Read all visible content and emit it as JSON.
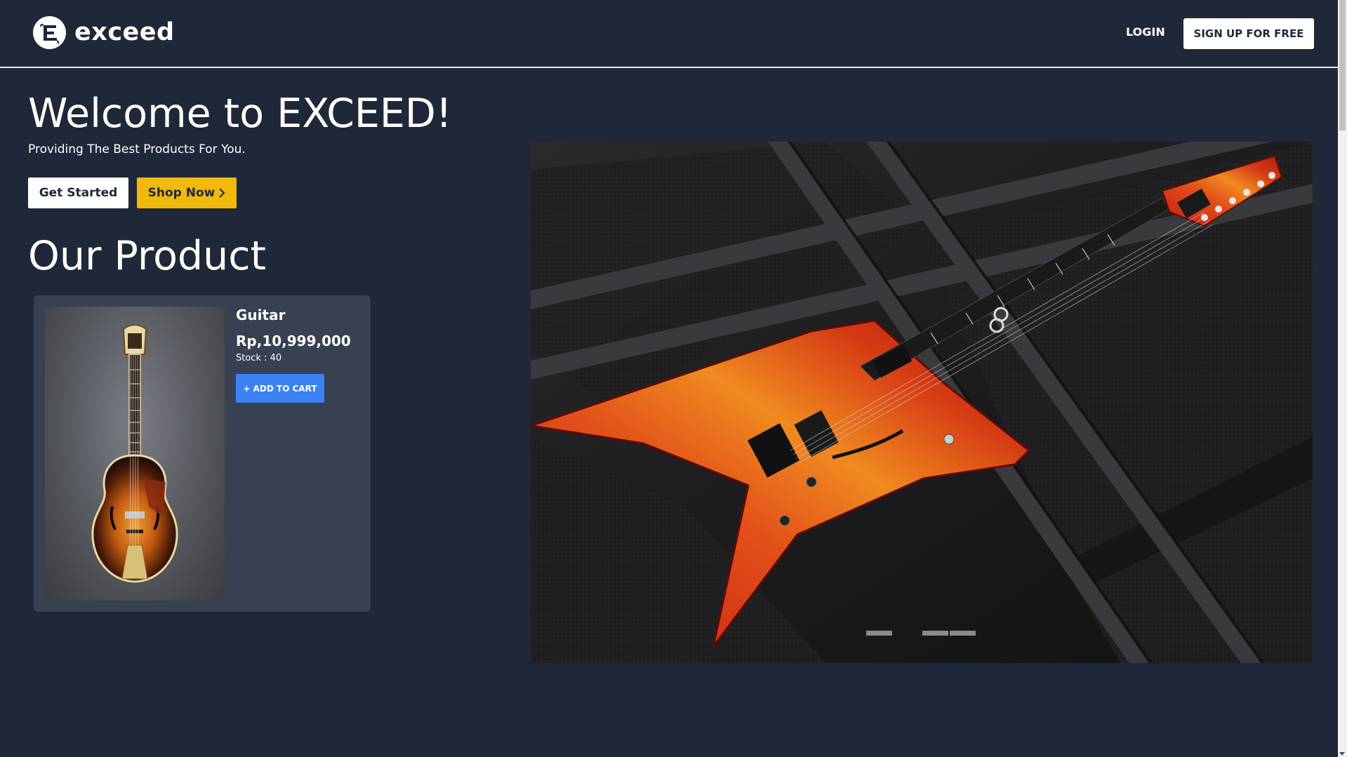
{
  "brand": {
    "name": "exceed",
    "logo_letter": "E"
  },
  "nav": {
    "login_label": "LOGIN",
    "signup_label": "SIGN UP FOR FREE"
  },
  "hero": {
    "title": "Welcome to EXCEED!",
    "subtitle": "Providing The Best Products For You.",
    "get_started_label": "Get Started",
    "shop_now_label": "Shop Now"
  },
  "products_section": {
    "title": "Our Product",
    "items": [
      {
        "name": "Guitar",
        "price": "Rp,10,999,000",
        "stock": "Stock : 40",
        "add_to_cart_label": "+ ADD TO CART",
        "image_icon": "archtop-guitar-image"
      }
    ]
  },
  "carousel": {
    "image_icon": "electric-guitar-on-amp-image",
    "slide_count": 3,
    "active_slide": 2
  },
  "colors": {
    "background": "#1e2838",
    "card": "#374152",
    "accent_yellow": "#f0b90b",
    "accent_blue": "#3b82f6",
    "header_border": "#e6e9ee"
  }
}
